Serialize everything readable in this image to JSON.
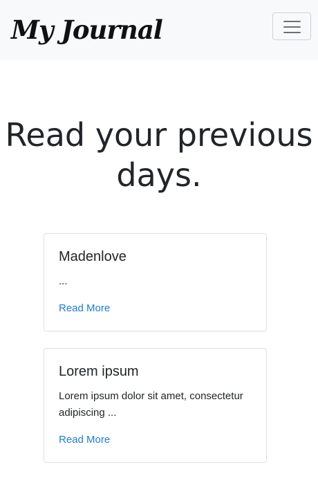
{
  "navbar": {
    "brand": "My Journal",
    "toggler_icon": "hamburger-menu-icon"
  },
  "main": {
    "heading": "Read your previous days.",
    "entries": [
      {
        "title": "Madenlove",
        "excerpt": "...",
        "link_label": "Read More"
      },
      {
        "title": "Lorem ipsum",
        "excerpt": "Lorem ipsum dolor sit amet, consectetur adipiscing ...",
        "link_label": "Read More"
      }
    ]
  },
  "colors": {
    "navbar_background": "#f8f9fa",
    "link": "#1e7be0",
    "text": "#212529",
    "card_border": "#dcdfe2"
  }
}
